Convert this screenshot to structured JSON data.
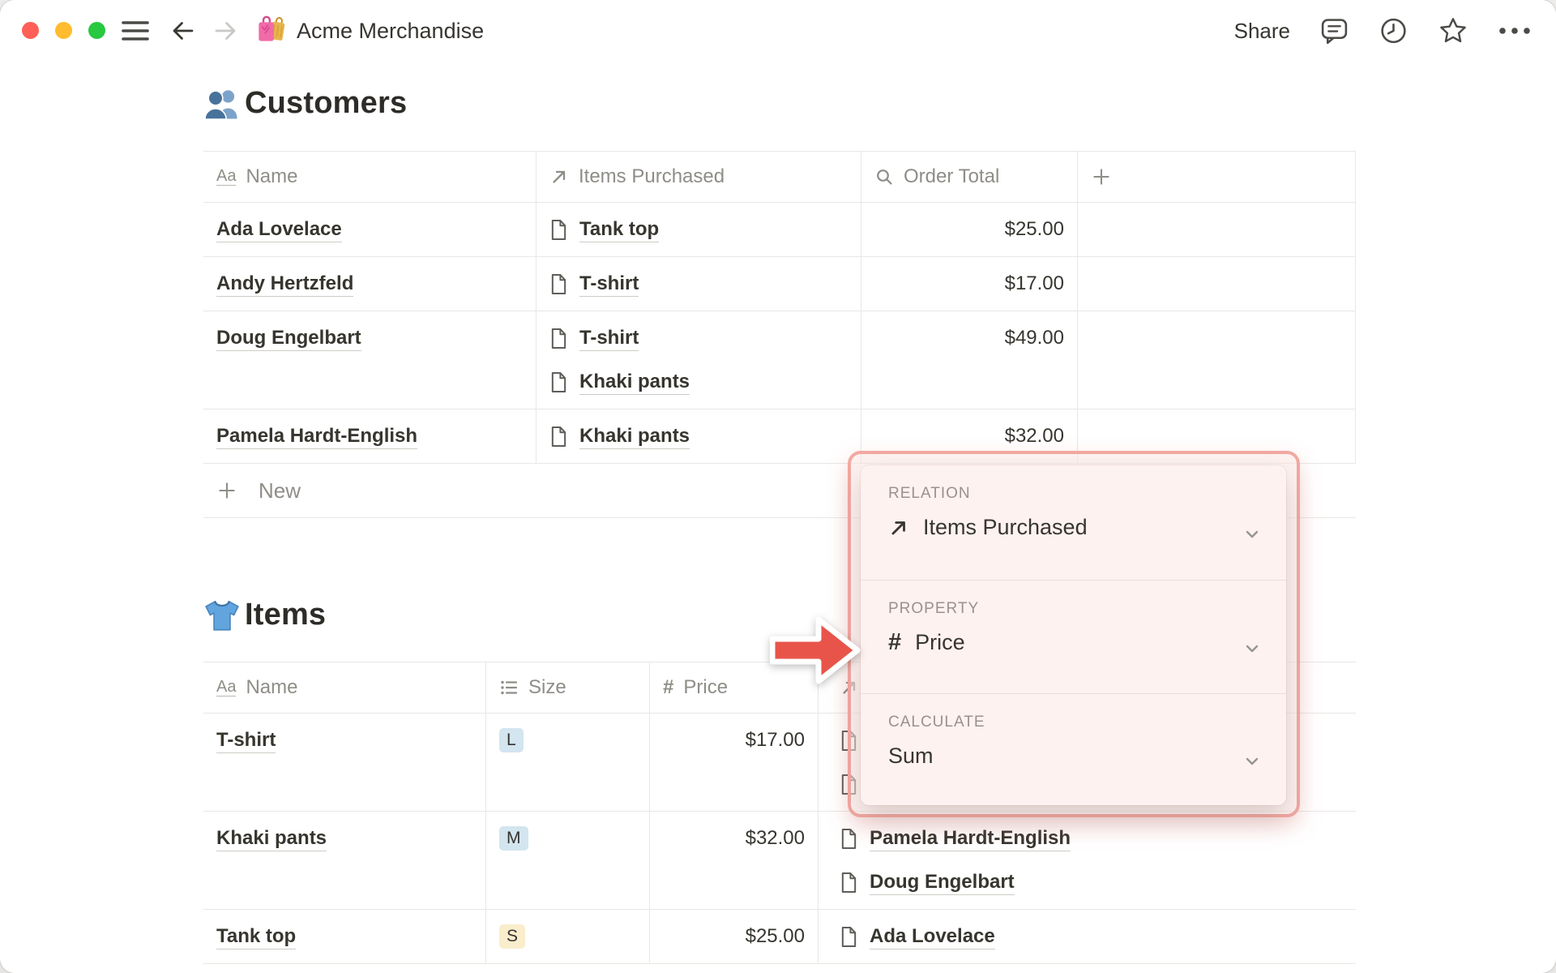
{
  "window": {
    "title": "Acme Merchandise",
    "title_icon": "shopping-bags-icon",
    "share_label": "Share",
    "controls": [
      "close",
      "minimize",
      "zoom"
    ]
  },
  "customers_table": {
    "heading": "Customers",
    "heading_icon": "people-icon",
    "columns": [
      {
        "label": "Name",
        "icon": "title-icon"
      },
      {
        "label": "Items Purchased",
        "icon": "relation-icon"
      },
      {
        "label": "Order Total",
        "icon": "rollup-icon"
      },
      {
        "label": "",
        "icon": "plus-icon"
      }
    ],
    "rows": [
      {
        "name": "Ada Lovelace",
        "items": [
          "Tank top"
        ],
        "order_total": "$25.00"
      },
      {
        "name": "Andy Hertzfeld",
        "items": [
          "T-shirt"
        ],
        "order_total": "$17.00"
      },
      {
        "name": "Doug Engelbart",
        "items": [
          "T-shirt",
          "Khaki pants"
        ],
        "order_total": "$49.00"
      },
      {
        "name": "Pamela Hardt-English",
        "items": [
          "Khaki pants"
        ],
        "order_total": "$32.00"
      }
    ],
    "new_row_label": "New"
  },
  "items_table": {
    "heading": "Items",
    "heading_icon": "tshirt-icon",
    "columns": [
      {
        "label": "Name",
        "icon": "title-icon"
      },
      {
        "label": "Size",
        "icon": "select-icon"
      },
      {
        "label": "Price",
        "icon": "number-icon"
      },
      {
        "label": "",
        "icon": "relation-icon"
      }
    ],
    "rows": [
      {
        "name": "T-shirt",
        "size": "L",
        "size_color": "#d3e5ef",
        "price": "$17.00",
        "purchased_by": [
          "",
          ""
        ]
      },
      {
        "name": "Khaki pants",
        "size": "M",
        "size_color": "#d3e5ef",
        "price": "$32.00",
        "purchased_by": [
          "Pamela Hardt-English",
          "Doug Engelbart"
        ]
      },
      {
        "name": "Tank top",
        "size": "S",
        "size_color": "#faedcc",
        "price": "$25.00",
        "purchased_by": [
          "Ada Lovelace"
        ]
      }
    ]
  },
  "popup": {
    "sections": [
      {
        "label": "RELATION",
        "value": "Items Purchased",
        "value_icon": "relation-icon"
      },
      {
        "label": "PROPERTY",
        "value": "Price",
        "value_icon": "number-icon"
      },
      {
        "label": "CALCULATE",
        "value": "Sum",
        "value_icon": null
      }
    ],
    "highlight_border_color": "#f2a9a2",
    "panel_bg": "#fdf2ef"
  },
  "annotation_arrow": {
    "color": "#e8544a",
    "direction": "right"
  },
  "colors": {
    "traffic_red": "#ff5f57",
    "traffic_yellow": "#febc2e",
    "traffic_green": "#28c840",
    "text": "#37352f",
    "muted": "#8f8d87",
    "table_line": "#e8e7e4",
    "badge_blue": "#d3e5ef",
    "badge_yellow": "#faedcc"
  }
}
